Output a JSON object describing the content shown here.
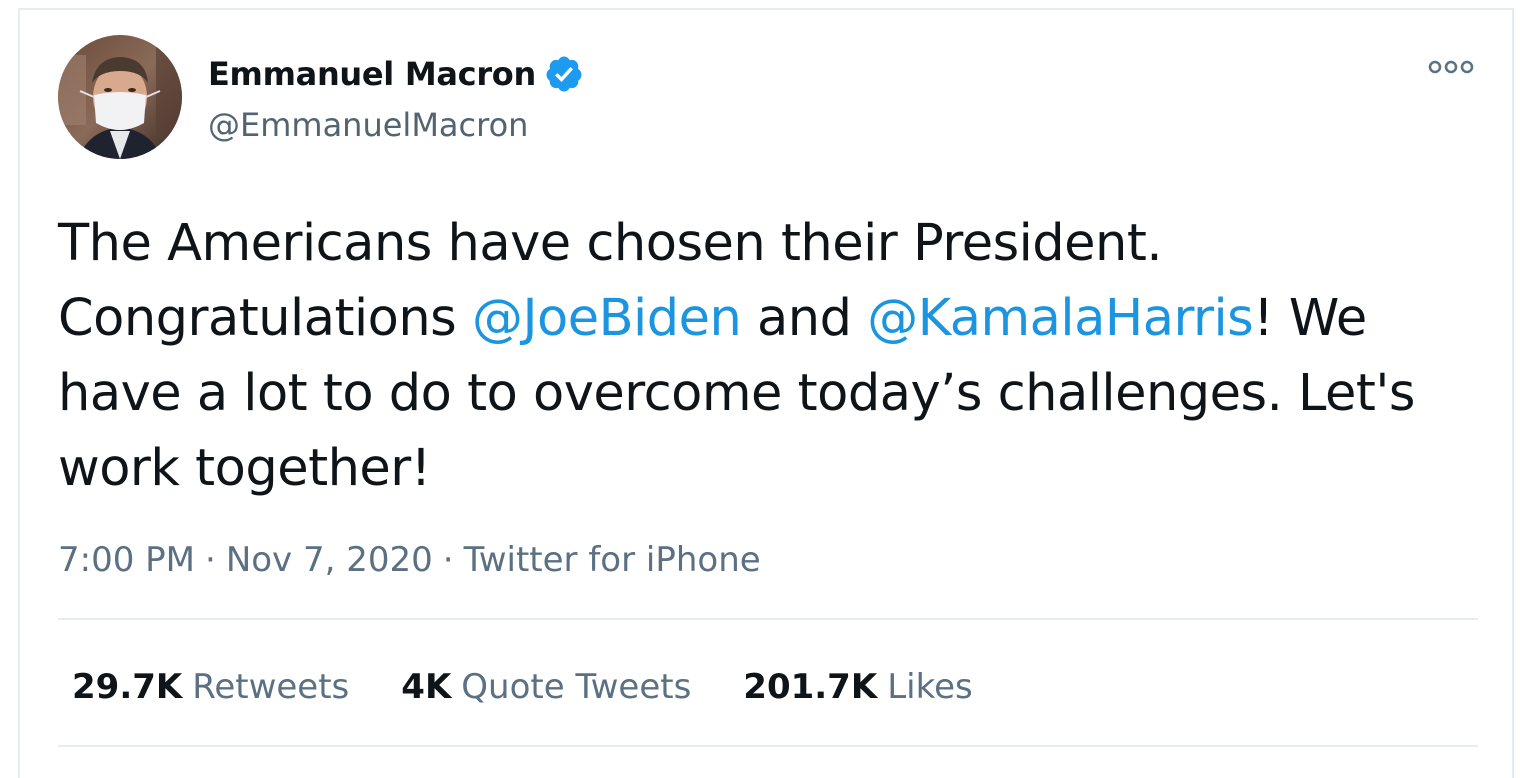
{
  "author": {
    "display_name": "Emmanuel Macron",
    "handle": "@EmmanuelMacron",
    "verified": true
  },
  "tweet": {
    "line1": "The Americans have chosen their President.",
    "line2_prefix": "Congratulations ",
    "mention1": "@JoeBiden",
    "line2_mid": " and ",
    "mention2": "@KamalaHarris",
    "line2_suffix": "! We",
    "line3": "have a lot to do to overcome today’s challenges. Let's",
    "line4": "work together!"
  },
  "meta": {
    "time": "7:00 PM",
    "separator": "·",
    "date": "Nov 7, 2020",
    "source": "Twitter for iPhone"
  },
  "stats": {
    "retweets_count": "29.7K",
    "retweets_label": "Retweets",
    "quotes_count": "4K",
    "quotes_label": "Quote Tweets",
    "likes_count": "201.7K",
    "likes_label": "Likes"
  },
  "icons": {
    "verified": "verified-badge-icon",
    "more": "more-options-icon"
  },
  "colors": {
    "mention": "#1b95e0",
    "verified": "#1d9bf0",
    "secondary_text": "#5b7083"
  }
}
